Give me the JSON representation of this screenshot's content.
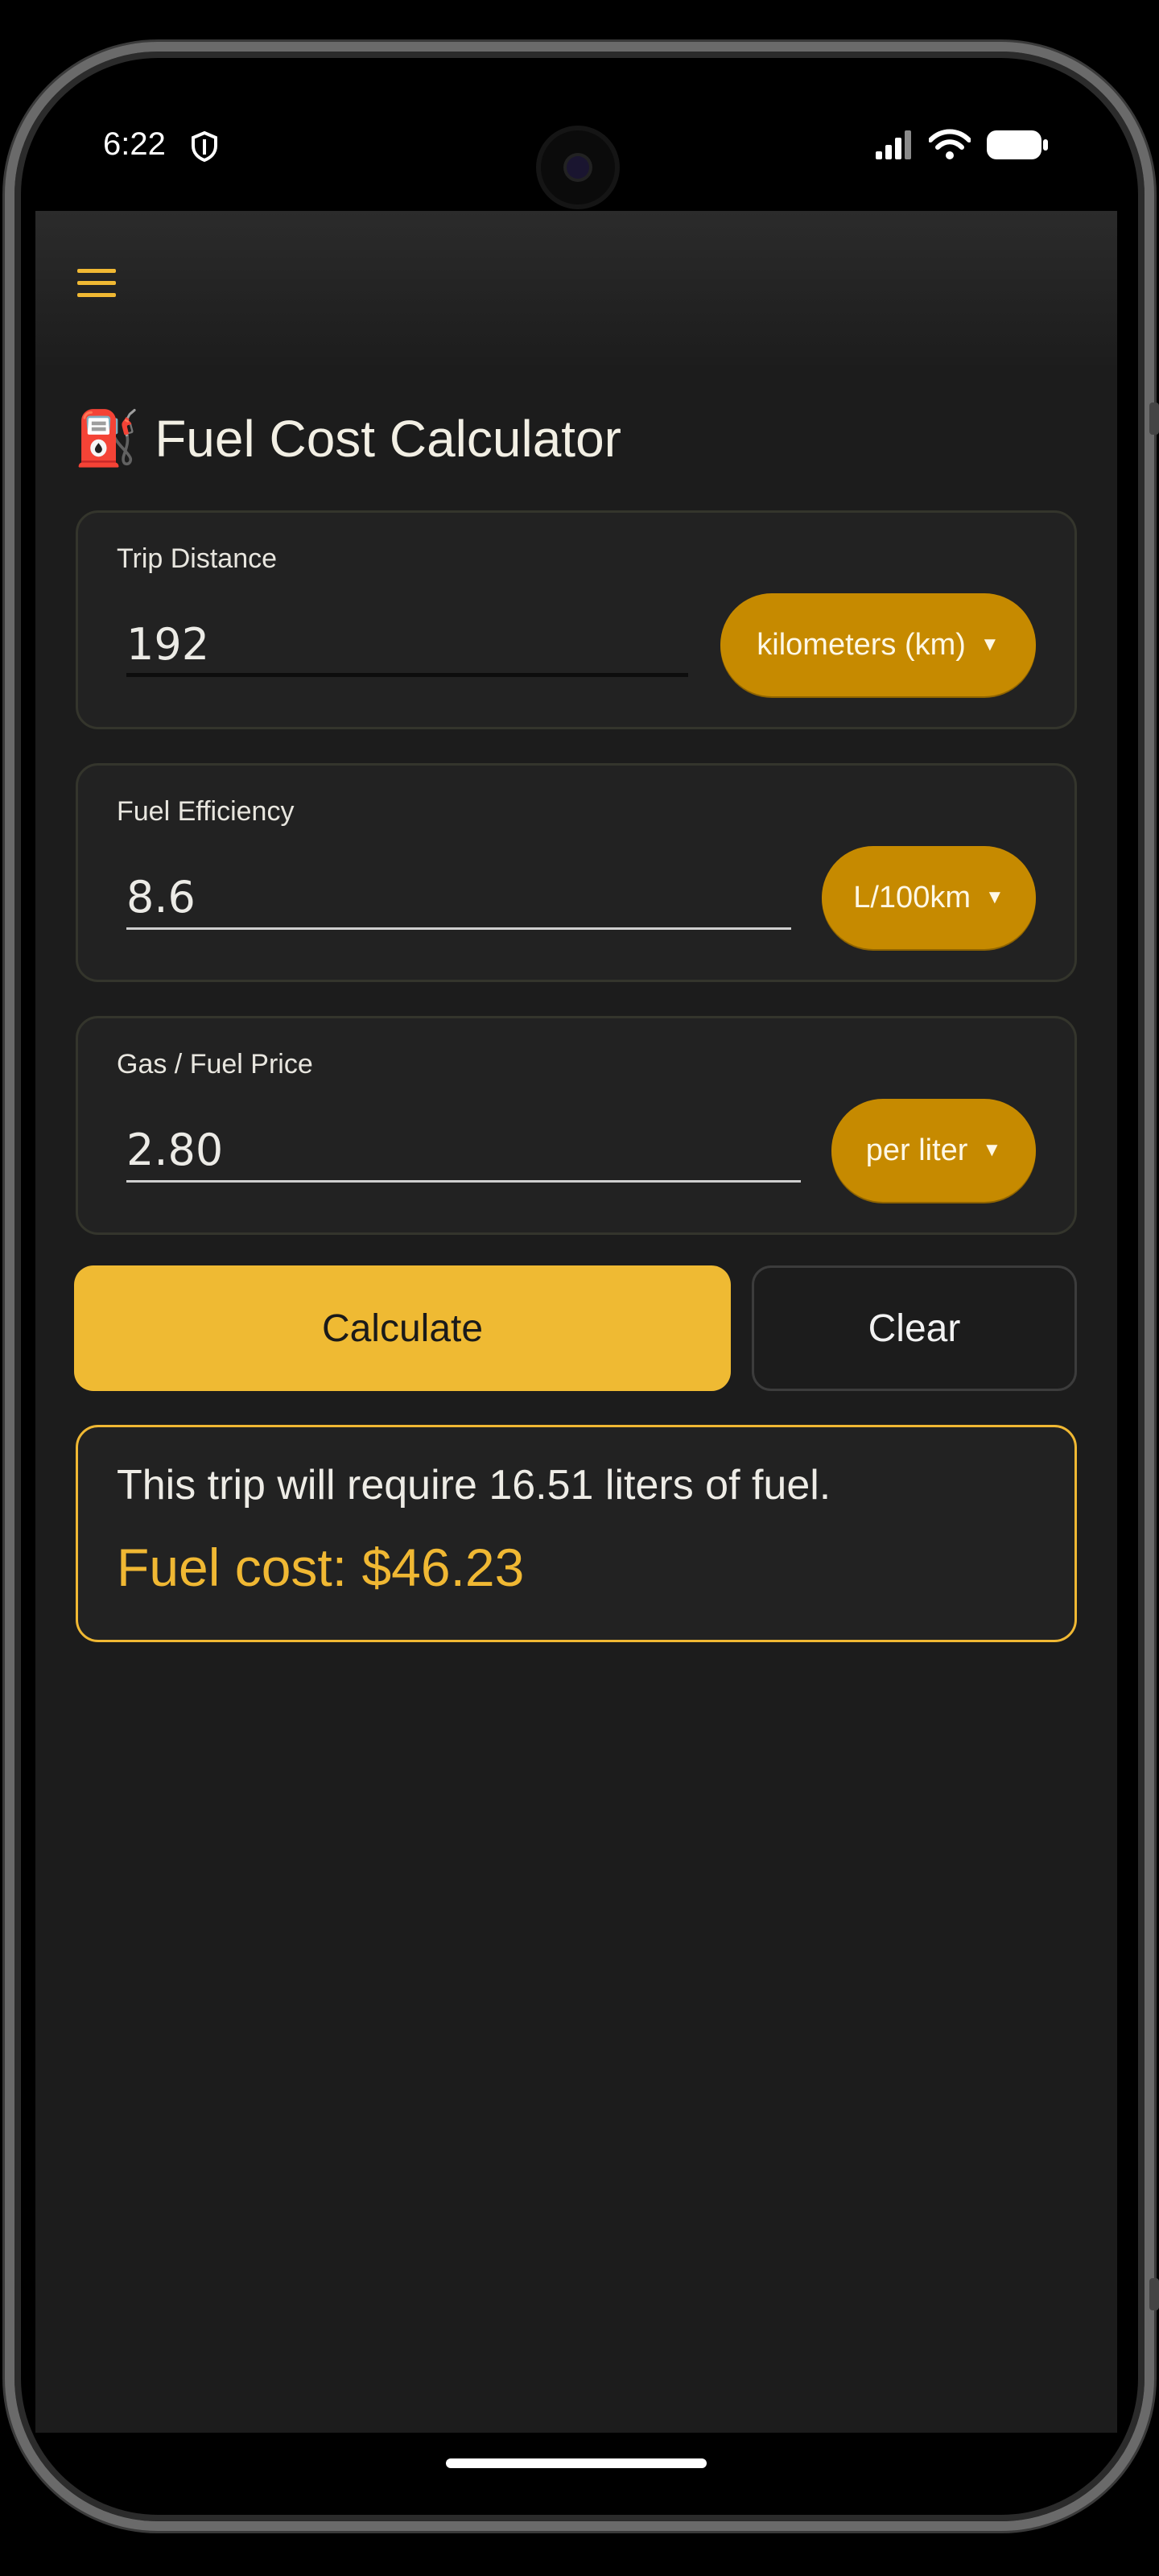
{
  "status_bar": {
    "time": "6:22"
  },
  "header": {
    "menu_icon": "hamburger-menu-icon"
  },
  "page": {
    "title_emoji": "⛽",
    "title": "Fuel Cost Calculator"
  },
  "inputs": {
    "distance": {
      "label": "Trip Distance",
      "value": "192",
      "unit": "kilometers (km)"
    },
    "efficiency": {
      "label": "Fuel Efficiency",
      "value": "8.6",
      "unit": "L/100km"
    },
    "price": {
      "label": "Gas / Fuel Price",
      "value": "2.80",
      "unit": "per liter"
    }
  },
  "buttons": {
    "calculate": "Calculate",
    "clear": "Clear"
  },
  "result": {
    "summary": "This trip will require 16.51 liters of fuel.",
    "cost": "Fuel cost: $46.23"
  },
  "colors": {
    "accent": "#efba33",
    "pill": "#c68a00",
    "background": "#1c1c1c",
    "card": "#222222"
  }
}
